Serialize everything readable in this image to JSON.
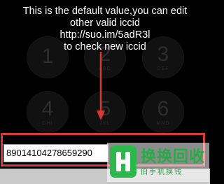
{
  "keypad": {
    "keys": [
      {
        "number": "1",
        "letters": ""
      },
      {
        "number": "2",
        "letters": "ABC"
      },
      {
        "number": "3",
        "letters": "DEF"
      },
      {
        "number": "4",
        "letters": "GHI"
      },
      {
        "number": "5",
        "letters": "JKL"
      },
      {
        "number": "6",
        "letters": "MNO"
      }
    ]
  },
  "annotation": {
    "line1": "This is the default value,you can edit",
    "line2": "other valid iccid",
    "line3": "http://suo.im/5adR3l",
    "line4": "to check new iccid"
  },
  "iccid_field": {
    "value": "89014104278659290"
  },
  "colors": {
    "highlight_frame": "#d43b35",
    "arrow": "#d43b35",
    "watermark_green": "#2cb84a"
  },
  "watermark": {
    "title": "换换回收",
    "subtitle": "旧手机换钱",
    "icon": "hh-logo-icon"
  }
}
